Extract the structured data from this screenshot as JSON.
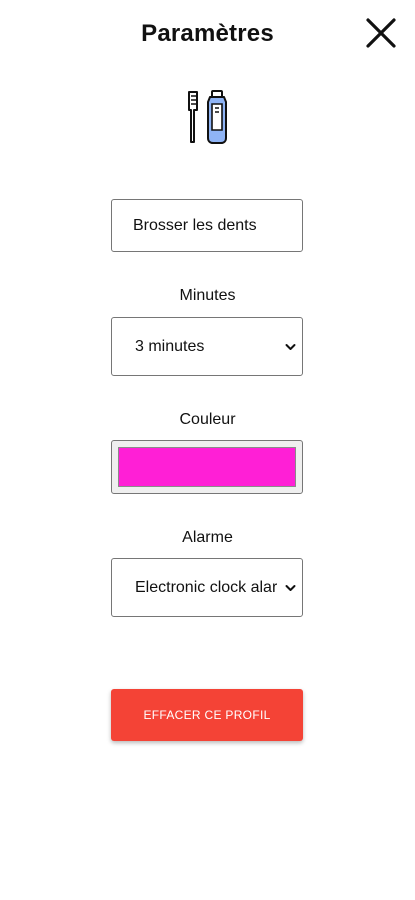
{
  "header": {
    "title": "Paramètres",
    "close_icon": "close-icon"
  },
  "app_icon": "toothbrush-toothpaste-icon",
  "profile": {
    "name_value": "Brosser les dents"
  },
  "minutes": {
    "label": "Minutes",
    "selected": "3 minutes"
  },
  "color": {
    "label": "Couleur",
    "value": "#ff1fd6"
  },
  "alarm": {
    "label": "Alarme",
    "selected": "Electronic clock alarm"
  },
  "actions": {
    "delete_label": "EFFACER CE PROFIL",
    "delete_color": "#f44336"
  }
}
